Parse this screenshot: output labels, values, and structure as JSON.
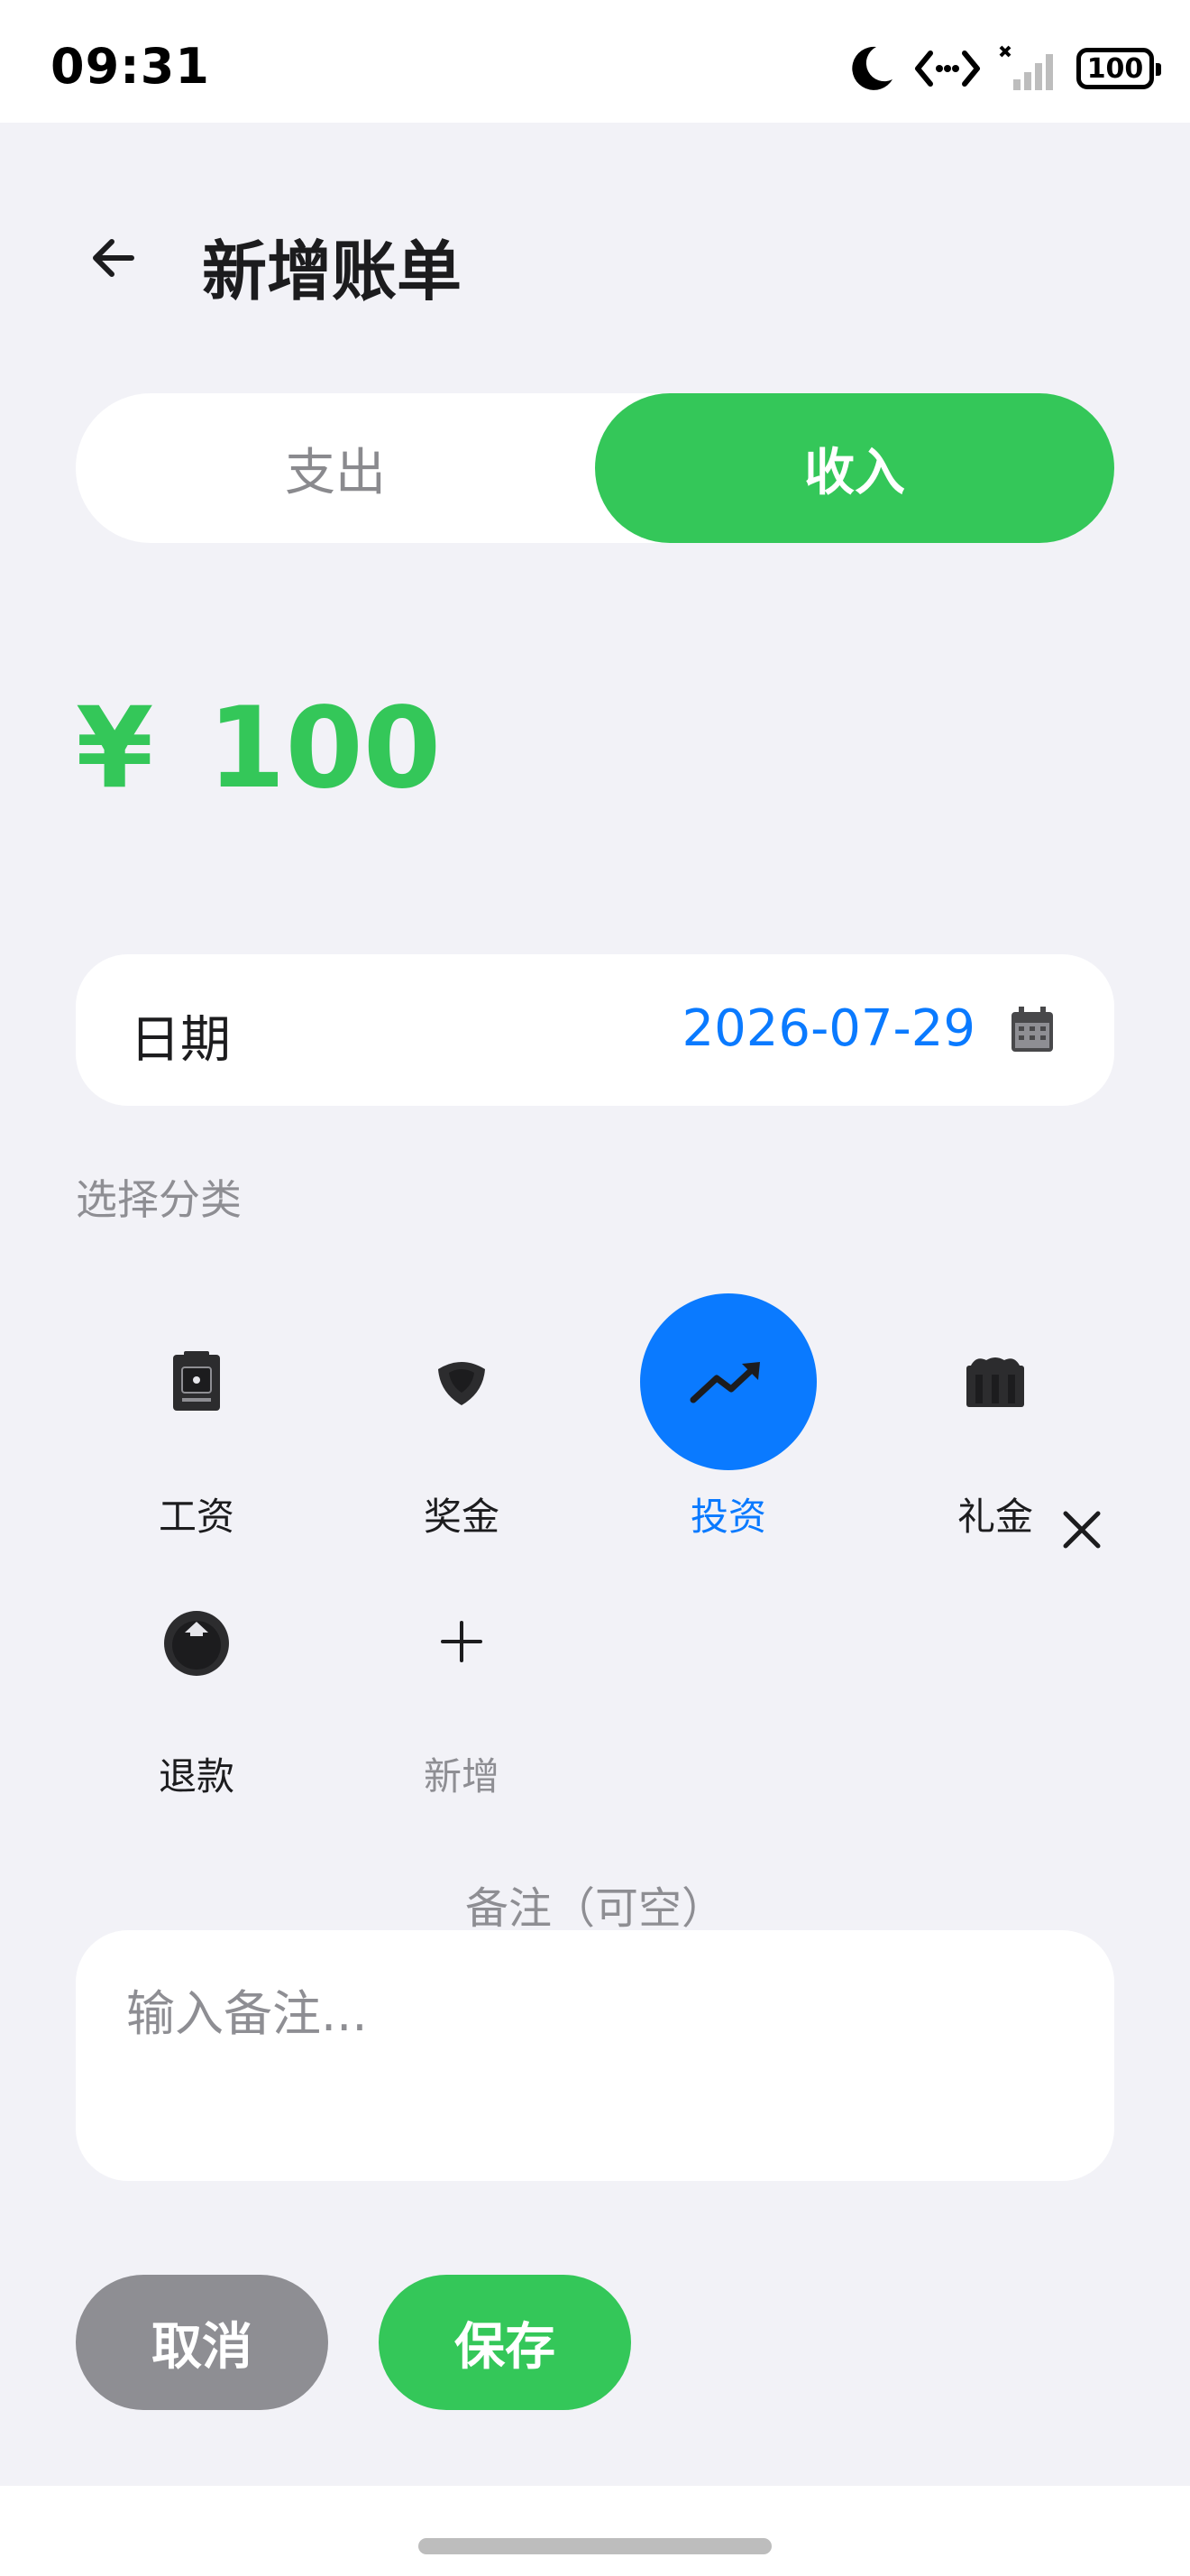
{
  "status_bar": {
    "time": "09:31",
    "battery": "100"
  },
  "header": {
    "title": "新增账单"
  },
  "segmented": {
    "expense": "支出",
    "income": "收入",
    "selected": "income"
  },
  "amount": {
    "currency": "¥",
    "value": "100",
    "color": "#34C759"
  },
  "date_row": {
    "label": "日期",
    "value": "2026-07-29"
  },
  "categories": {
    "title": "选择分类",
    "items": [
      {
        "label": "工资",
        "icon": "wallet-icon"
      },
      {
        "label": "奖金",
        "icon": "badge-icon"
      },
      {
        "label": "投资",
        "icon": "trend-up-icon",
        "selected": true
      },
      {
        "label": "礼金",
        "icon": "gift-icon"
      },
      {
        "label": "退款",
        "icon": "refund-icon"
      },
      {
        "label": "新增",
        "icon": "plus-icon"
      }
    ]
  },
  "note": {
    "label": "备注（可空）",
    "placeholder": "输入备注..."
  },
  "actions": {
    "cancel": "取消",
    "save": "保存"
  },
  "colors": {
    "accent_green": "#34C759",
    "accent_blue": "#0A7AFF",
    "muted_gray": "#8E8E93",
    "background": "#F2F2F7"
  }
}
